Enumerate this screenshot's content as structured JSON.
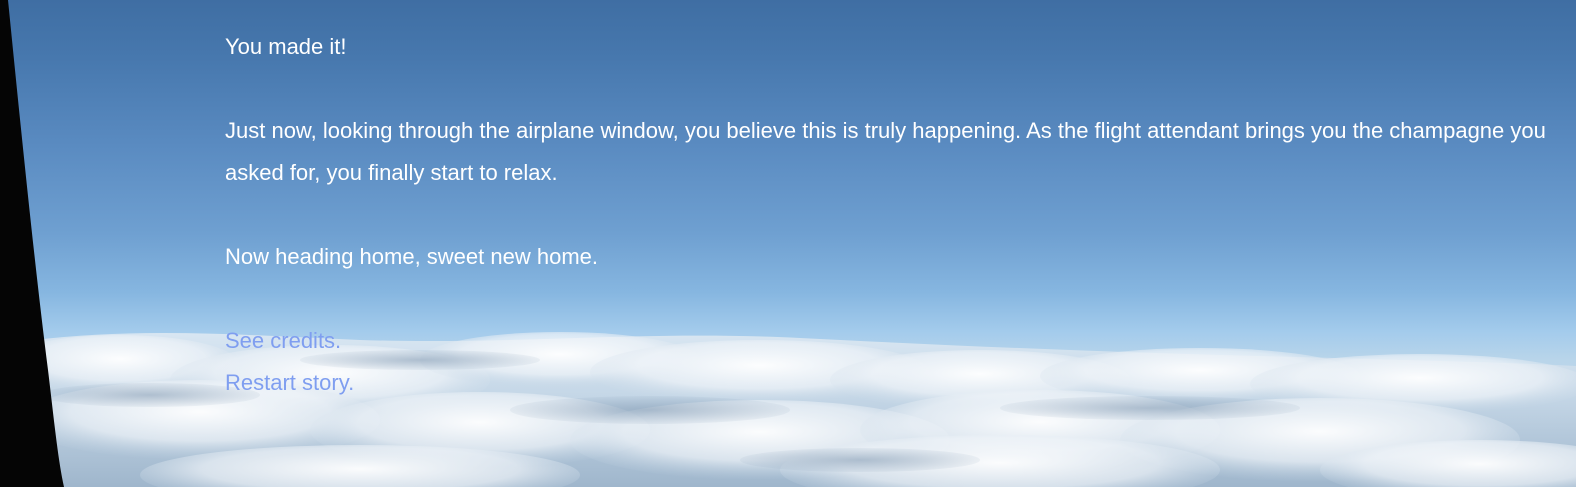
{
  "story": {
    "paragraphs": [
      "You made it!",
      "Just now, looking through the airplane window, you believe this is truly happening. As the flight attendant brings you the champagne you asked for, you finally start to relax.",
      "Now heading home, sweet new home."
    ]
  },
  "links": {
    "credits": "See credits.",
    "restart": "Restart story."
  },
  "colors": {
    "text": "#ffffff",
    "link": "#7f9ef0",
    "sky_top": "#3f6ea3",
    "sky_horizon": "#a3cbec",
    "cloud": "#eef3f8",
    "window_frame": "#050505"
  }
}
